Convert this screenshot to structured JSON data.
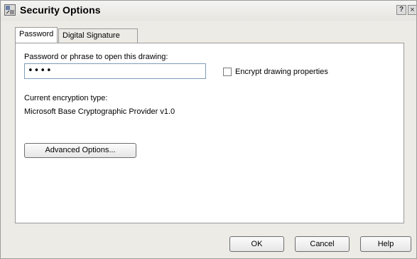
{
  "window": {
    "title": "Security Options",
    "help_glyph": "?",
    "close_glyph": "×"
  },
  "tabs": [
    {
      "label": "Password",
      "active": true
    },
    {
      "label": "Digital Signature",
      "active": false
    }
  ],
  "password": {
    "label": "Password or phrase to open this drawing:",
    "value": "••••",
    "encrypt_properties_label": "Encrypt drawing properties",
    "encrypt_properties_checked": false,
    "encryption_type_label": "Current encryption type:",
    "encryption_type_value": "Microsoft Base Cryptographic Provider v1.0",
    "advanced_button": "Advanced Options..."
  },
  "buttons": {
    "ok": "OK",
    "cancel": "Cancel",
    "help": "Help"
  }
}
